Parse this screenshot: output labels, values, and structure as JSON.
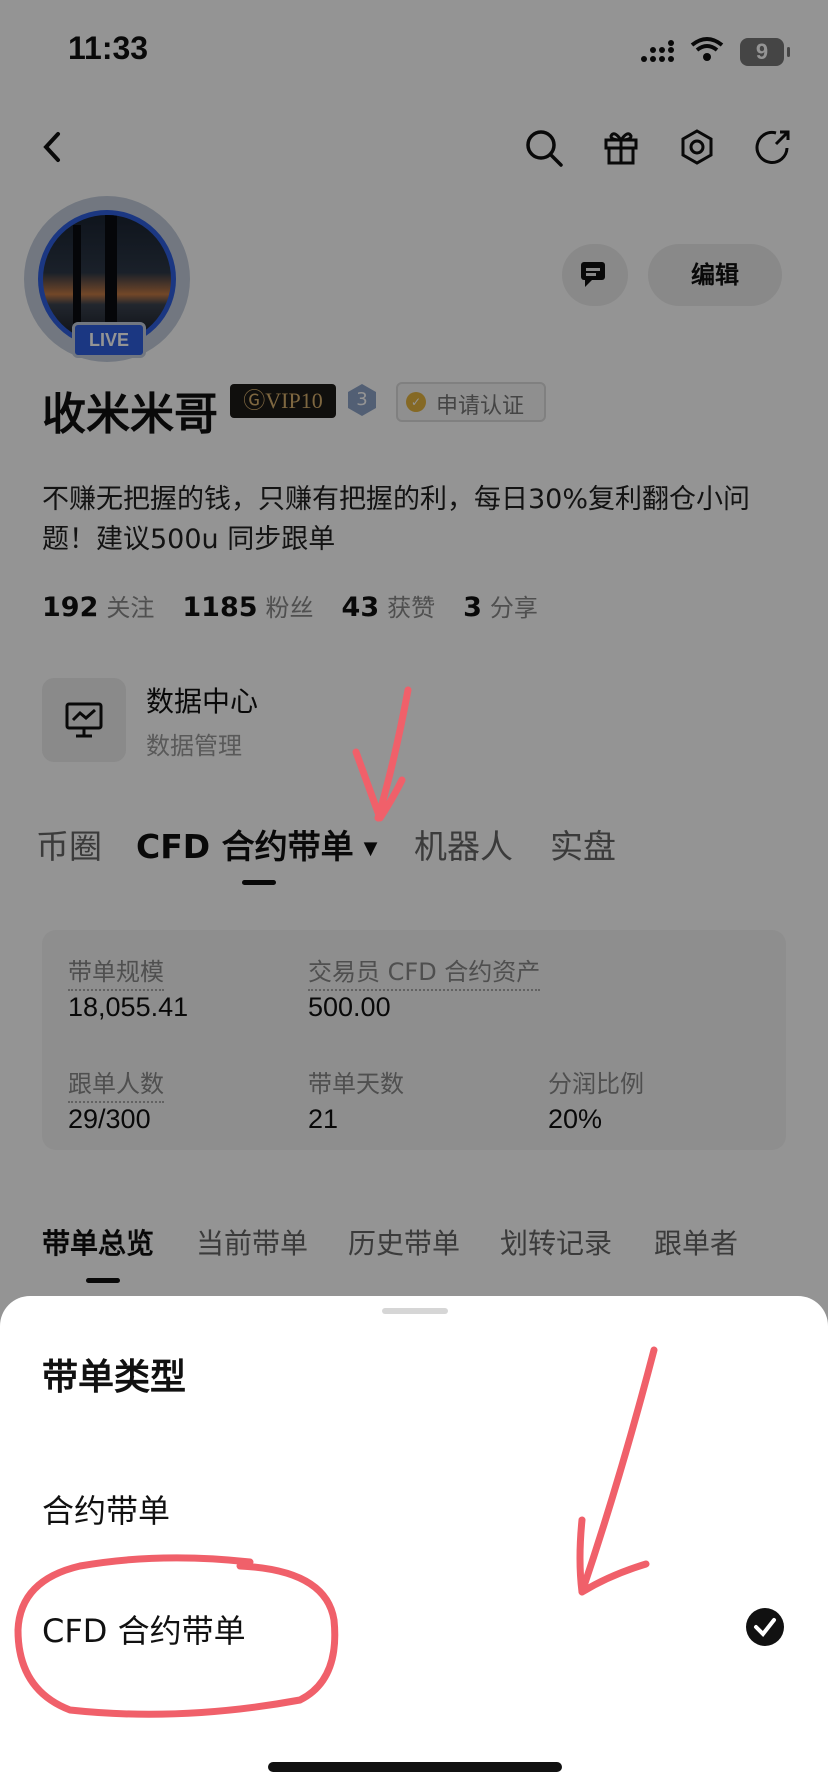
{
  "status_bar": {
    "time": "11:33",
    "battery": "9"
  },
  "header_icons": [
    "back-arrow-icon",
    "search-icon",
    "gift-icon",
    "settings-icon",
    "share-icon"
  ],
  "profile": {
    "live_badge": "LIVE",
    "edit_label": "编辑",
    "name": "收米米哥",
    "vip_badge": "VIP10",
    "level_badge": "3",
    "cert_label": "申请认证",
    "bio": "不赚无把握的钱，只赚有把握的利，每日30%复利翻仓小问题！建议500u 同步跟单",
    "stats": [
      {
        "value": "192",
        "label": "关注"
      },
      {
        "value": "1185",
        "label": "粉丝"
      },
      {
        "value": "43",
        "label": "获赞"
      },
      {
        "value": "3",
        "label": "分享"
      }
    ]
  },
  "data_center": {
    "title": "数据中心",
    "subtitle": "数据管理"
  },
  "main_tabs": [
    {
      "label": "币圈"
    },
    {
      "label": "CFD 合约带单",
      "active": true
    },
    {
      "label": "机器人"
    },
    {
      "label": "实盘"
    }
  ],
  "summary": {
    "scale_label": "带单规模",
    "scale_value": "18,055.41",
    "assets_label": "交易员 CFD 合约资产",
    "assets_value": "500.00",
    "followers_label": "跟单人数",
    "followers_value": "29/300",
    "days_label": "带单天数",
    "days_value": "21",
    "profit_label": "分润比例",
    "profit_value": "20%"
  },
  "sub_tabs": [
    "带单总览",
    "当前带单",
    "历史带单",
    "划转记录",
    "跟单者"
  ],
  "sheet": {
    "title": "带单类型",
    "options": [
      "合约带单",
      "CFD 合约带单"
    ],
    "selected_index": 1
  },
  "colors": {
    "accent": "#2f5fe0",
    "annotation": "#f0606a",
    "overlay": "#000000"
  }
}
